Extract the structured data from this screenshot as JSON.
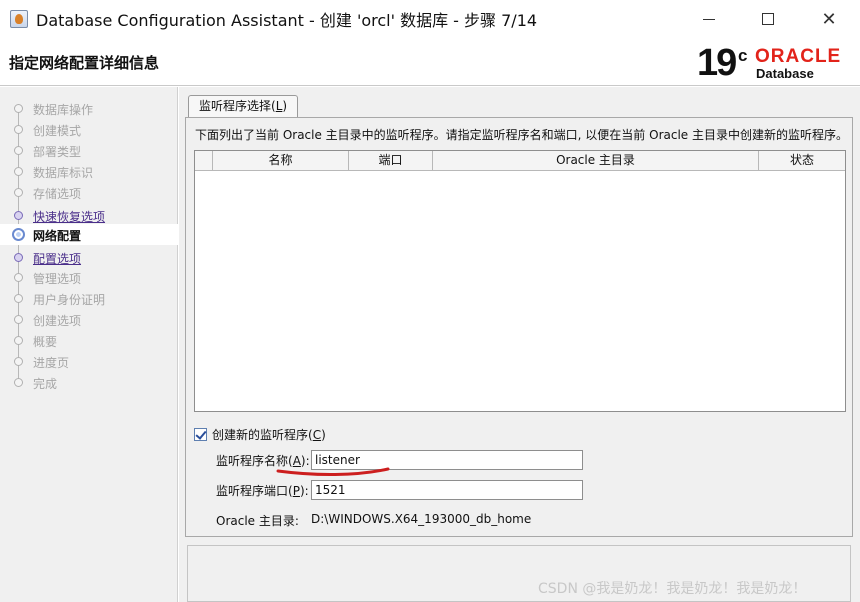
{
  "window": {
    "title": "Database Configuration Assistant - 创建 'orcl' 数据库 - 步骤 7/14",
    "minimize_icon": "minimize-icon",
    "maximize_icon": "maximize-icon",
    "close_icon": "close-icon",
    "close_glyph": "✕"
  },
  "header": {
    "page_title": "指定网络配置详细信息",
    "logo_version": "19",
    "logo_sup": "c",
    "logo_brand": "ORACLE",
    "logo_product": "Database",
    "brand_color": "#e2231a"
  },
  "nav": {
    "items": [
      {
        "label": "数据库操作",
        "state": "disabled"
      },
      {
        "label": "创建模式",
        "state": "disabled"
      },
      {
        "label": "部署类型",
        "state": "disabled"
      },
      {
        "label": "数据库标识",
        "state": "disabled"
      },
      {
        "label": "存储选项",
        "state": "disabled"
      },
      {
        "label": "快速恢复选项",
        "state": "link"
      },
      {
        "label": "网络配置",
        "state": "current"
      },
      {
        "label": "配置选项",
        "state": "link"
      },
      {
        "label": "管理选项",
        "state": "disabled"
      },
      {
        "label": "用户身份证明",
        "state": "disabled"
      },
      {
        "label": "创建选项",
        "state": "disabled"
      },
      {
        "label": "概要",
        "state": "disabled"
      },
      {
        "label": "进度页",
        "state": "disabled"
      },
      {
        "label": "完成",
        "state": "disabled"
      }
    ]
  },
  "main": {
    "tab_label": "监听程序选择(",
    "tab_mnemonic": "L",
    "tab_suffix": ")",
    "description": "下面列出了当前 Oracle 主目录中的监听程序。请指定监听程序名和端口, 以便在当前 Oracle 主目录中创建新的监听程序。",
    "table": {
      "columns": [
        "",
        "名称",
        "端口",
        "Oracle 主目录",
        "状态"
      ],
      "rows": []
    },
    "create_new": {
      "label": "创建新的监听程序(",
      "mnemonic": "C",
      "suffix": ")",
      "checked": true
    },
    "listener_name": {
      "label": "监听程序名称(",
      "mnemonic": "A",
      "suffix": "):",
      "value": "listener"
    },
    "listener_port": {
      "label": "监听程序端口(",
      "mnemonic": "P",
      "suffix": "):",
      "value": "1521"
    },
    "oracle_home": {
      "label": "Oracle 主目录:",
      "value": "D:\\WINDOWS.X64_193000_db_home"
    }
  },
  "watermark": "CSDN @我是奶龙！我是奶龙！我是奶龙！",
  "annotation_color": "#cc1e1e"
}
